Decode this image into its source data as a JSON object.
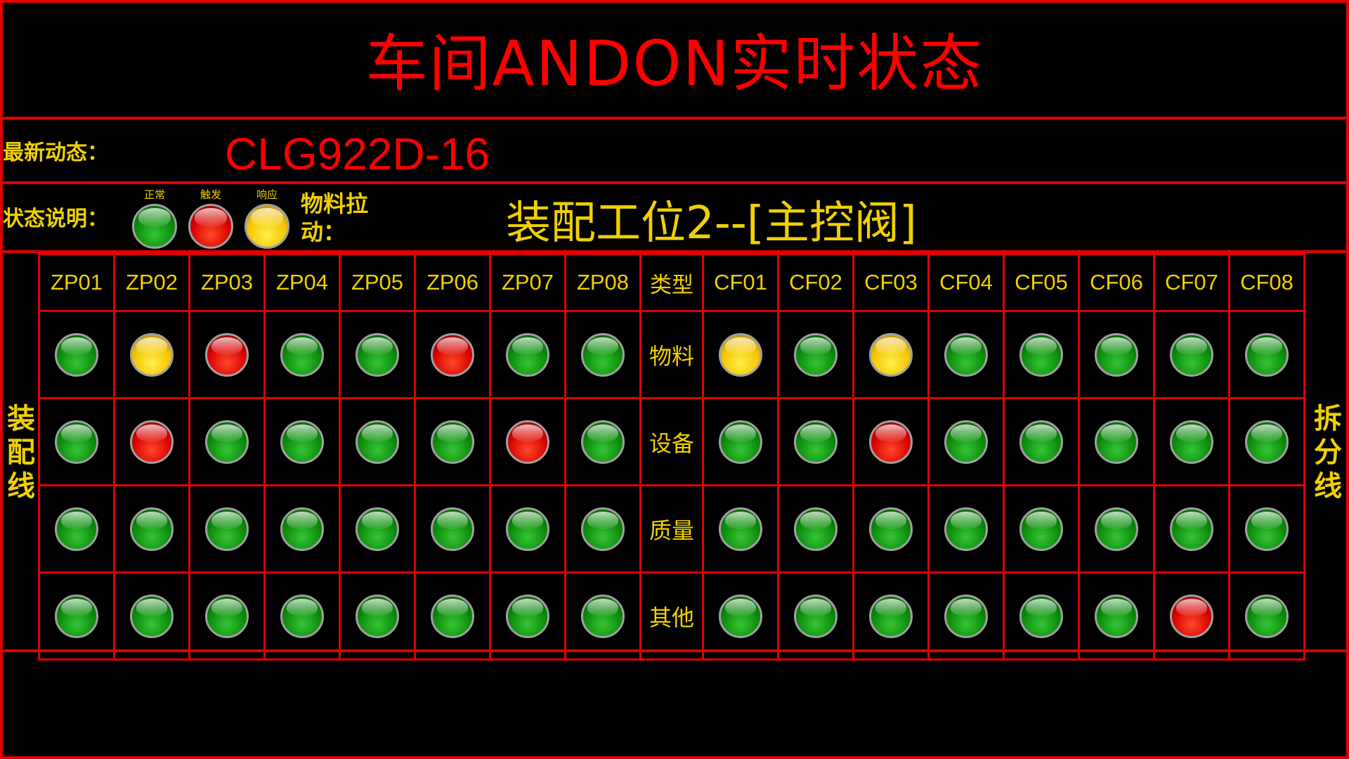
{
  "title": "车间ANDON实时状态",
  "latest": {
    "label": "最新动态：",
    "value": "CLG922D-16"
  },
  "legend": {
    "label": "状态说明：",
    "items": [
      {
        "caption": "正常",
        "status": "green"
      },
      {
        "caption": "触发",
        "status": "red"
      },
      {
        "caption": "响应",
        "status": "yellow"
      }
    ],
    "material_label": "物料拉动："
  },
  "station": "装配工位2--[主控阀]",
  "left_line": "装配线",
  "right_line": "拆分线",
  "columns": [
    "ZP01",
    "ZP02",
    "ZP03",
    "ZP04",
    "ZP05",
    "ZP06",
    "ZP07",
    "ZP08",
    "类型",
    "CF01",
    "CF02",
    "CF03",
    "CF04",
    "CF05",
    "CF06",
    "CF07",
    "CF08"
  ],
  "rows": [
    {
      "type": "物料",
      "left": [
        "green",
        "yellow",
        "red",
        "green",
        "green",
        "red",
        "green",
        "green"
      ],
      "right": [
        "yellow",
        "green",
        "yellow",
        "green",
        "green",
        "green",
        "green",
        "green"
      ]
    },
    {
      "type": "设备",
      "left": [
        "green",
        "red",
        "green",
        "green",
        "green",
        "green",
        "red",
        "green"
      ],
      "right": [
        "green",
        "green",
        "red",
        "green",
        "green",
        "green",
        "green",
        "green"
      ]
    },
    {
      "type": "质量",
      "left": [
        "green",
        "green",
        "green",
        "green",
        "green",
        "green",
        "green",
        "green"
      ],
      "right": [
        "green",
        "green",
        "green",
        "green",
        "green",
        "green",
        "green",
        "green"
      ]
    },
    {
      "type": "其他",
      "left": [
        "green",
        "green",
        "green",
        "green",
        "green",
        "green",
        "green",
        "green"
      ],
      "right": [
        "green",
        "green",
        "green",
        "green",
        "green",
        "green",
        "red",
        "green"
      ]
    }
  ],
  "colors": {
    "border": "#e00000",
    "title": "#ff0000",
    "label": "#f0d000",
    "normal": "green",
    "trigger": "red",
    "response": "yellow"
  }
}
